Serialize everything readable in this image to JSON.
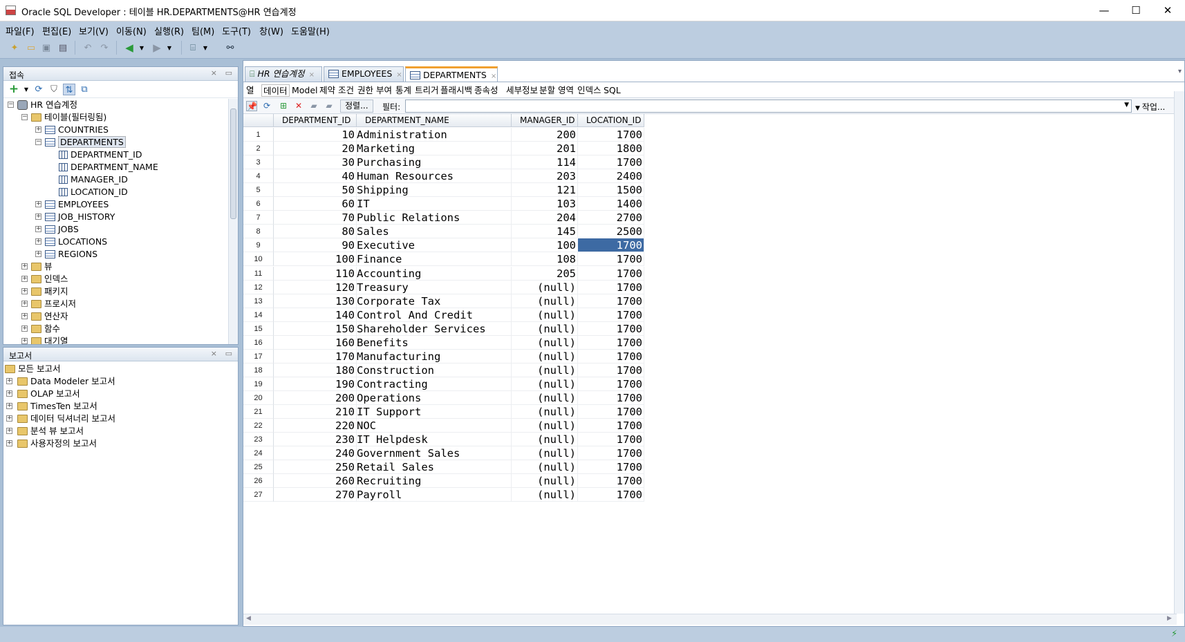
{
  "window": {
    "title": "Oracle SQL Developer : 테이블 HR.DEPARTMENTS@HR 연습계정",
    "minimize": "—",
    "maximize": "☐",
    "close": "✕"
  },
  "menu": [
    "파일(F)",
    "편집(E)",
    "보기(V)",
    "이동(N)",
    "실행(R)",
    "팀(M)",
    "도구(T)",
    "창(W)",
    "도움말(H)"
  ],
  "connections": {
    "title": "접속",
    "tree": [
      {
        "label": "HR 연습계정",
        "level": 0,
        "icon": "db-icon",
        "expanded": true
      },
      {
        "label": "테이블(필터링됨)",
        "level": 1,
        "icon": "folder-icon",
        "expanded": true
      },
      {
        "label": "COUNTRIES",
        "level": 2,
        "icon": "table-icon",
        "expanded": false
      },
      {
        "label": "DEPARTMENTS",
        "level": 2,
        "icon": "table-icon",
        "expanded": true,
        "selected": true
      },
      {
        "label": "DEPARTMENT_ID",
        "level": 3,
        "icon": "column-icon"
      },
      {
        "label": "DEPARTMENT_NAME",
        "level": 3,
        "icon": "column-icon"
      },
      {
        "label": "MANAGER_ID",
        "level": 3,
        "icon": "column-icon"
      },
      {
        "label": "LOCATION_ID",
        "level": 3,
        "icon": "column-icon"
      },
      {
        "label": "EMPLOYEES",
        "level": 2,
        "icon": "table-icon",
        "expanded": false
      },
      {
        "label": "JOB_HISTORY",
        "level": 2,
        "icon": "table-icon",
        "expanded": false
      },
      {
        "label": "JOBS",
        "level": 2,
        "icon": "table-icon",
        "expanded": false
      },
      {
        "label": "LOCATIONS",
        "level": 2,
        "icon": "table-icon",
        "expanded": false
      },
      {
        "label": "REGIONS",
        "level": 2,
        "icon": "table-icon",
        "expanded": false
      },
      {
        "label": "뷰",
        "level": 1,
        "icon": "folder-icon",
        "expanded": false
      },
      {
        "label": "인덱스",
        "level": 1,
        "icon": "folder-icon",
        "expanded": false
      },
      {
        "label": "패키지",
        "level": 1,
        "icon": "folder-icon",
        "expanded": false
      },
      {
        "label": "프로시저",
        "level": 1,
        "icon": "folder-icon",
        "expanded": false
      },
      {
        "label": "연산자",
        "level": 1,
        "icon": "folder-icon",
        "expanded": false
      },
      {
        "label": "함수",
        "level": 1,
        "icon": "folder-icon",
        "expanded": false
      },
      {
        "label": "대기열",
        "level": 1,
        "icon": "folder-icon",
        "expanded": false
      }
    ]
  },
  "reports": {
    "title": "보고서",
    "tree": [
      {
        "label": "모든 보고서",
        "level": 0,
        "icon": "folder-icon"
      },
      {
        "label": "Data Modeler 보고서",
        "level": 1,
        "icon": "folder-icon"
      },
      {
        "label": "OLAP 보고서",
        "level": 1,
        "icon": "folder-icon"
      },
      {
        "label": "TimesTen 보고서",
        "level": 1,
        "icon": "folder-icon"
      },
      {
        "label": "데이터 딕셔너리 보고서",
        "level": 1,
        "icon": "folder-icon"
      },
      {
        "label": "분석 뷰 보고서",
        "level": 1,
        "icon": "folder-icon"
      },
      {
        "label": "사용자정의 보고서",
        "level": 1,
        "icon": "folder-icon"
      }
    ]
  },
  "doc_tabs": [
    {
      "label": "HR 연습계정",
      "icon": "worksheet-icon",
      "active": false
    },
    {
      "label": "EMPLOYEES",
      "icon": "table-icon",
      "active": false
    },
    {
      "label": "DEPARTMENTS",
      "icon": "table-icon",
      "active": true
    }
  ],
  "sub_tabs": [
    "열",
    "데이터",
    "Model",
    "제약 조건",
    "권한 부여",
    "통계",
    "트리거",
    "플래시백",
    "종속성",
    "세부정보",
    "분할 영역",
    "인덱스",
    "SQL"
  ],
  "active_sub_tab": "데이터",
  "grid_toolbar": {
    "sort_label": "정렬...",
    "filter_label": "필터:",
    "filter_value": "",
    "actions_label": "작업..."
  },
  "grid": {
    "columns": [
      "DEPARTMENT_ID",
      "DEPARTMENT_NAME",
      "MANAGER_ID",
      "LOCATION_ID"
    ],
    "rows": [
      [
        "10",
        "Administration",
        "200",
        "1700"
      ],
      [
        "20",
        "Marketing",
        "201",
        "1800"
      ],
      [
        "30",
        "Purchasing",
        "114",
        "1700"
      ],
      [
        "40",
        "Human Resources",
        "203",
        "2400"
      ],
      [
        "50",
        "Shipping",
        "121",
        "1500"
      ],
      [
        "60",
        "IT",
        "103",
        "1400"
      ],
      [
        "70",
        "Public Relations",
        "204",
        "2700"
      ],
      [
        "80",
        "Sales",
        "145",
        "2500"
      ],
      [
        "90",
        "Executive",
        "100",
        "1700"
      ],
      [
        "100",
        "Finance",
        "108",
        "1700"
      ],
      [
        "110",
        "Accounting",
        "205",
        "1700"
      ],
      [
        "120",
        "Treasury",
        "(null)",
        "1700"
      ],
      [
        "130",
        "Corporate Tax",
        "(null)",
        "1700"
      ],
      [
        "140",
        "Control And Credit",
        "(null)",
        "1700"
      ],
      [
        "150",
        "Shareholder Services",
        "(null)",
        "1700"
      ],
      [
        "160",
        "Benefits",
        "(null)",
        "1700"
      ],
      [
        "170",
        "Manufacturing",
        "(null)",
        "1700"
      ],
      [
        "180",
        "Construction",
        "(null)",
        "1700"
      ],
      [
        "190",
        "Contracting",
        "(null)",
        "1700"
      ],
      [
        "200",
        "Operations",
        "(null)",
        "1700"
      ],
      [
        "210",
        "IT Support",
        "(null)",
        "1700"
      ],
      [
        "220",
        "NOC",
        "(null)",
        "1700"
      ],
      [
        "230",
        "IT Helpdesk",
        "(null)",
        "1700"
      ],
      [
        "240",
        "Government Sales",
        "(null)",
        "1700"
      ],
      [
        "250",
        "Retail Sales",
        "(null)",
        "1700"
      ],
      [
        "260",
        "Recruiting",
        "(null)",
        "1700"
      ],
      [
        "270",
        "Payroll",
        "(null)",
        "1700"
      ]
    ],
    "selected_row": 9,
    "selected_column": "LOCATION_ID"
  },
  "colors": {
    "accent": "#3d6aa3",
    "frame": "#a9bfd6",
    "active_tab": "#f0a030"
  }
}
